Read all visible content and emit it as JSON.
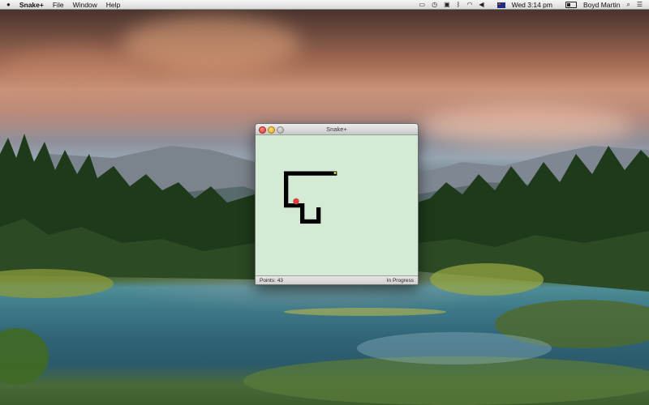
{
  "menubar": {
    "apple": "",
    "app_name": "Snake+",
    "menus": [
      "File",
      "Window",
      "Help"
    ],
    "status_icons": [
      "airplay-icon",
      "time-machine-icon",
      "lock-icon",
      "bluetooth-icon",
      "wifi-icon",
      "volume-icon",
      "flag-icon"
    ],
    "clock": "Wed 3:14 pm",
    "user": "Boyd Martin",
    "search_icon": "⌕",
    "list_icon": "☰"
  },
  "window": {
    "title": "Snake+",
    "status": {
      "points_label": "Points:",
      "points_value": "43",
      "state": "In Progress"
    },
    "game": {
      "cols": 40,
      "rows": 35,
      "snake_color": "#000000",
      "head_color": "#d8d43a",
      "food_color": "#d9413a",
      "board_color": "#d4ead5",
      "snake": [
        [
          19,
          9
        ],
        [
          18,
          9
        ],
        [
          17,
          9
        ],
        [
          16,
          9
        ],
        [
          15,
          9
        ],
        [
          14,
          9
        ],
        [
          13,
          9
        ],
        [
          12,
          9
        ],
        [
          11,
          9
        ],
        [
          10,
          9
        ],
        [
          9,
          9
        ],
        [
          8,
          9
        ],
        [
          7,
          9
        ],
        [
          7,
          10
        ],
        [
          7,
          11
        ],
        [
          7,
          12
        ],
        [
          7,
          13
        ],
        [
          7,
          14
        ],
        [
          7,
          15
        ],
        [
          7,
          16
        ],
        [
          7,
          17
        ],
        [
          8,
          17
        ],
        [
          9,
          17
        ],
        [
          10,
          17
        ],
        [
          11,
          17
        ],
        [
          11,
          18
        ],
        [
          11,
          19
        ],
        [
          11,
          20
        ],
        [
          11,
          21
        ],
        [
          12,
          21
        ],
        [
          13,
          21
        ],
        [
          14,
          21
        ],
        [
          15,
          21
        ],
        [
          15,
          20
        ],
        [
          15,
          19
        ],
        [
          15,
          18
        ]
      ],
      "food": [
        10,
        16.5
      ]
    }
  }
}
